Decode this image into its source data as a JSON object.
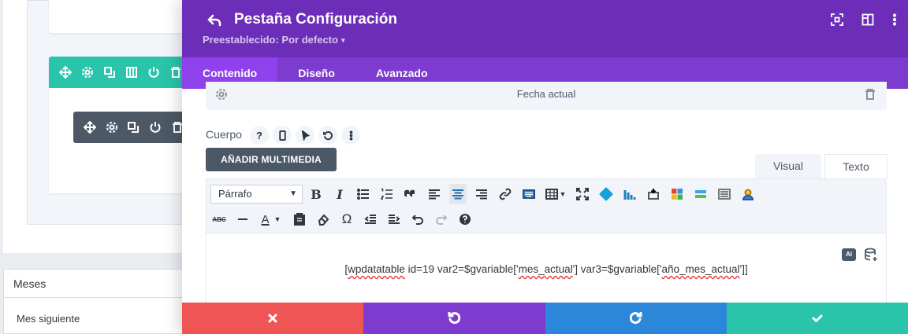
{
  "modal": {
    "title": "Pestaña Configuración",
    "preset_label": "Preestablecido: Por defecto",
    "preset_caret": "▾",
    "header_color": "#6c2eb9",
    "tabs_color": "#7e3bd0"
  },
  "tabs": [
    {
      "label": "Contenido",
      "active": true
    },
    {
      "label": "Diseño",
      "active": false
    },
    {
      "label": "Avanzado",
      "active": false
    }
  ],
  "field": {
    "label": "Fecha actual"
  },
  "cuerpo": {
    "label": "Cuerpo",
    "help_glyph": "?"
  },
  "buttons": {
    "add_media": "AÑADIR MULTIMEDIA"
  },
  "editor_tabs": {
    "visual": "Visual",
    "texto": "Texto"
  },
  "toolbar": {
    "format_value": "Párrafo",
    "format_caret": "▼",
    "bold": "B",
    "italic": "I",
    "strikethrough": "ABC",
    "text_color": "A",
    "omega": "Ω"
  },
  "content": {
    "sc_1": "[",
    "sc_2": "wpdatatable",
    "sc_3": " id=19 var2=$gvariable['",
    "sc_4": "mes_actual",
    "sc_5": "'] var3=$gvariable['",
    "sc_6": "año_mes_actual",
    "sc_7": "']]",
    "ai_badge": "AI"
  },
  "background": {
    "meses_header": "Meses",
    "meses_item": "Mes siguiente",
    "row_color": "#29c4a9",
    "module_color": "#4c5866"
  },
  "footer": {
    "colors": [
      "#ef5555",
      "#7e3bd0",
      "#2b87da",
      "#29c4a9"
    ]
  }
}
